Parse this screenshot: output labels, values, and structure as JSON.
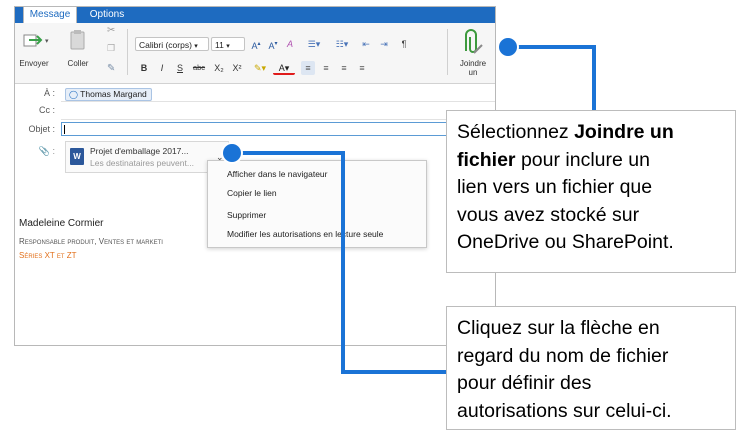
{
  "tabs": [
    {
      "label": "Message"
    },
    {
      "label": "Options"
    }
  ],
  "ribbon": {
    "send_label": "Envoyer",
    "paste_label": "Coller",
    "font_name": "Calibri (corps)",
    "font_size": "11",
    "attach_label_1": "Joindre",
    "attach_label_2": "un",
    "bold": "B",
    "italic": "I",
    "strike": "S",
    "abc": "abc",
    "subscript": "X₂",
    "superscript": "X²"
  },
  "fields": {
    "to_label": "À :",
    "cc_label": "Cc :",
    "subject_label": "Objet :",
    "attach_label": "📎 :",
    "to_value": "Thomas Margand"
  },
  "attachment": {
    "name": "Projet d'emballage 2017...",
    "subtitle": "Les destinataires peuvent...",
    "icon": "word-icon"
  },
  "context_menu": {
    "items": [
      {
        "label": "Afficher dans le navigateur"
      },
      {
        "label": "Copier le lien"
      },
      {
        "label": "Supprimer"
      },
      {
        "label": "Modifier les autorisations en lecture seule"
      }
    ]
  },
  "signature": {
    "name": "Madeleine Cormier",
    "title": "Responsable produit, Ventes et marketi",
    "series": "Séries XT et ZT"
  },
  "callouts": {
    "first": {
      "line1_prefix": "Sélectionnez ",
      "line1_bold": "Joindre un",
      "line2_bold": "fichier",
      "line2_rest": " pour inclure un",
      "line3": "lien vers un fichier que",
      "line4": "vous avez stocké sur",
      "line5": "OneDrive ou SharePoint."
    },
    "second": {
      "line1": "Cliquez sur la flèche en",
      "line2": "regard du nom de fichier",
      "line3": "pour définir des",
      "line4": "autorisations sur celui-ci."
    }
  },
  "colors": {
    "accent": "#1e6bc0",
    "callout_line": "#1a73d6",
    "signature_orange": "#e2701b",
    "word_blue": "#2b579a"
  }
}
